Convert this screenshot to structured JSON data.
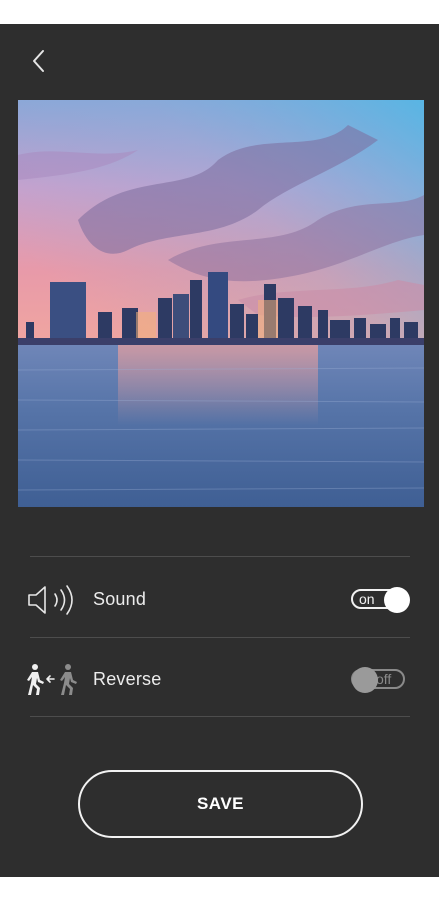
{
  "header": {
    "back_icon": "chevron-left-icon"
  },
  "preview": {
    "image": "city-skyline-at-sunset-over-water"
  },
  "settings": {
    "sound": {
      "label": "Sound",
      "icon": "speaker-icon",
      "state": "on"
    },
    "reverse": {
      "label": "Reverse",
      "icon": "walk-reverse-icon",
      "state": "off"
    }
  },
  "actions": {
    "save_label": "SAVE"
  },
  "colors": {
    "background": "#2e2e2e",
    "divider": "#4d4d4d",
    "text": "#ececec",
    "toggle_off": "#8a8a8a"
  }
}
